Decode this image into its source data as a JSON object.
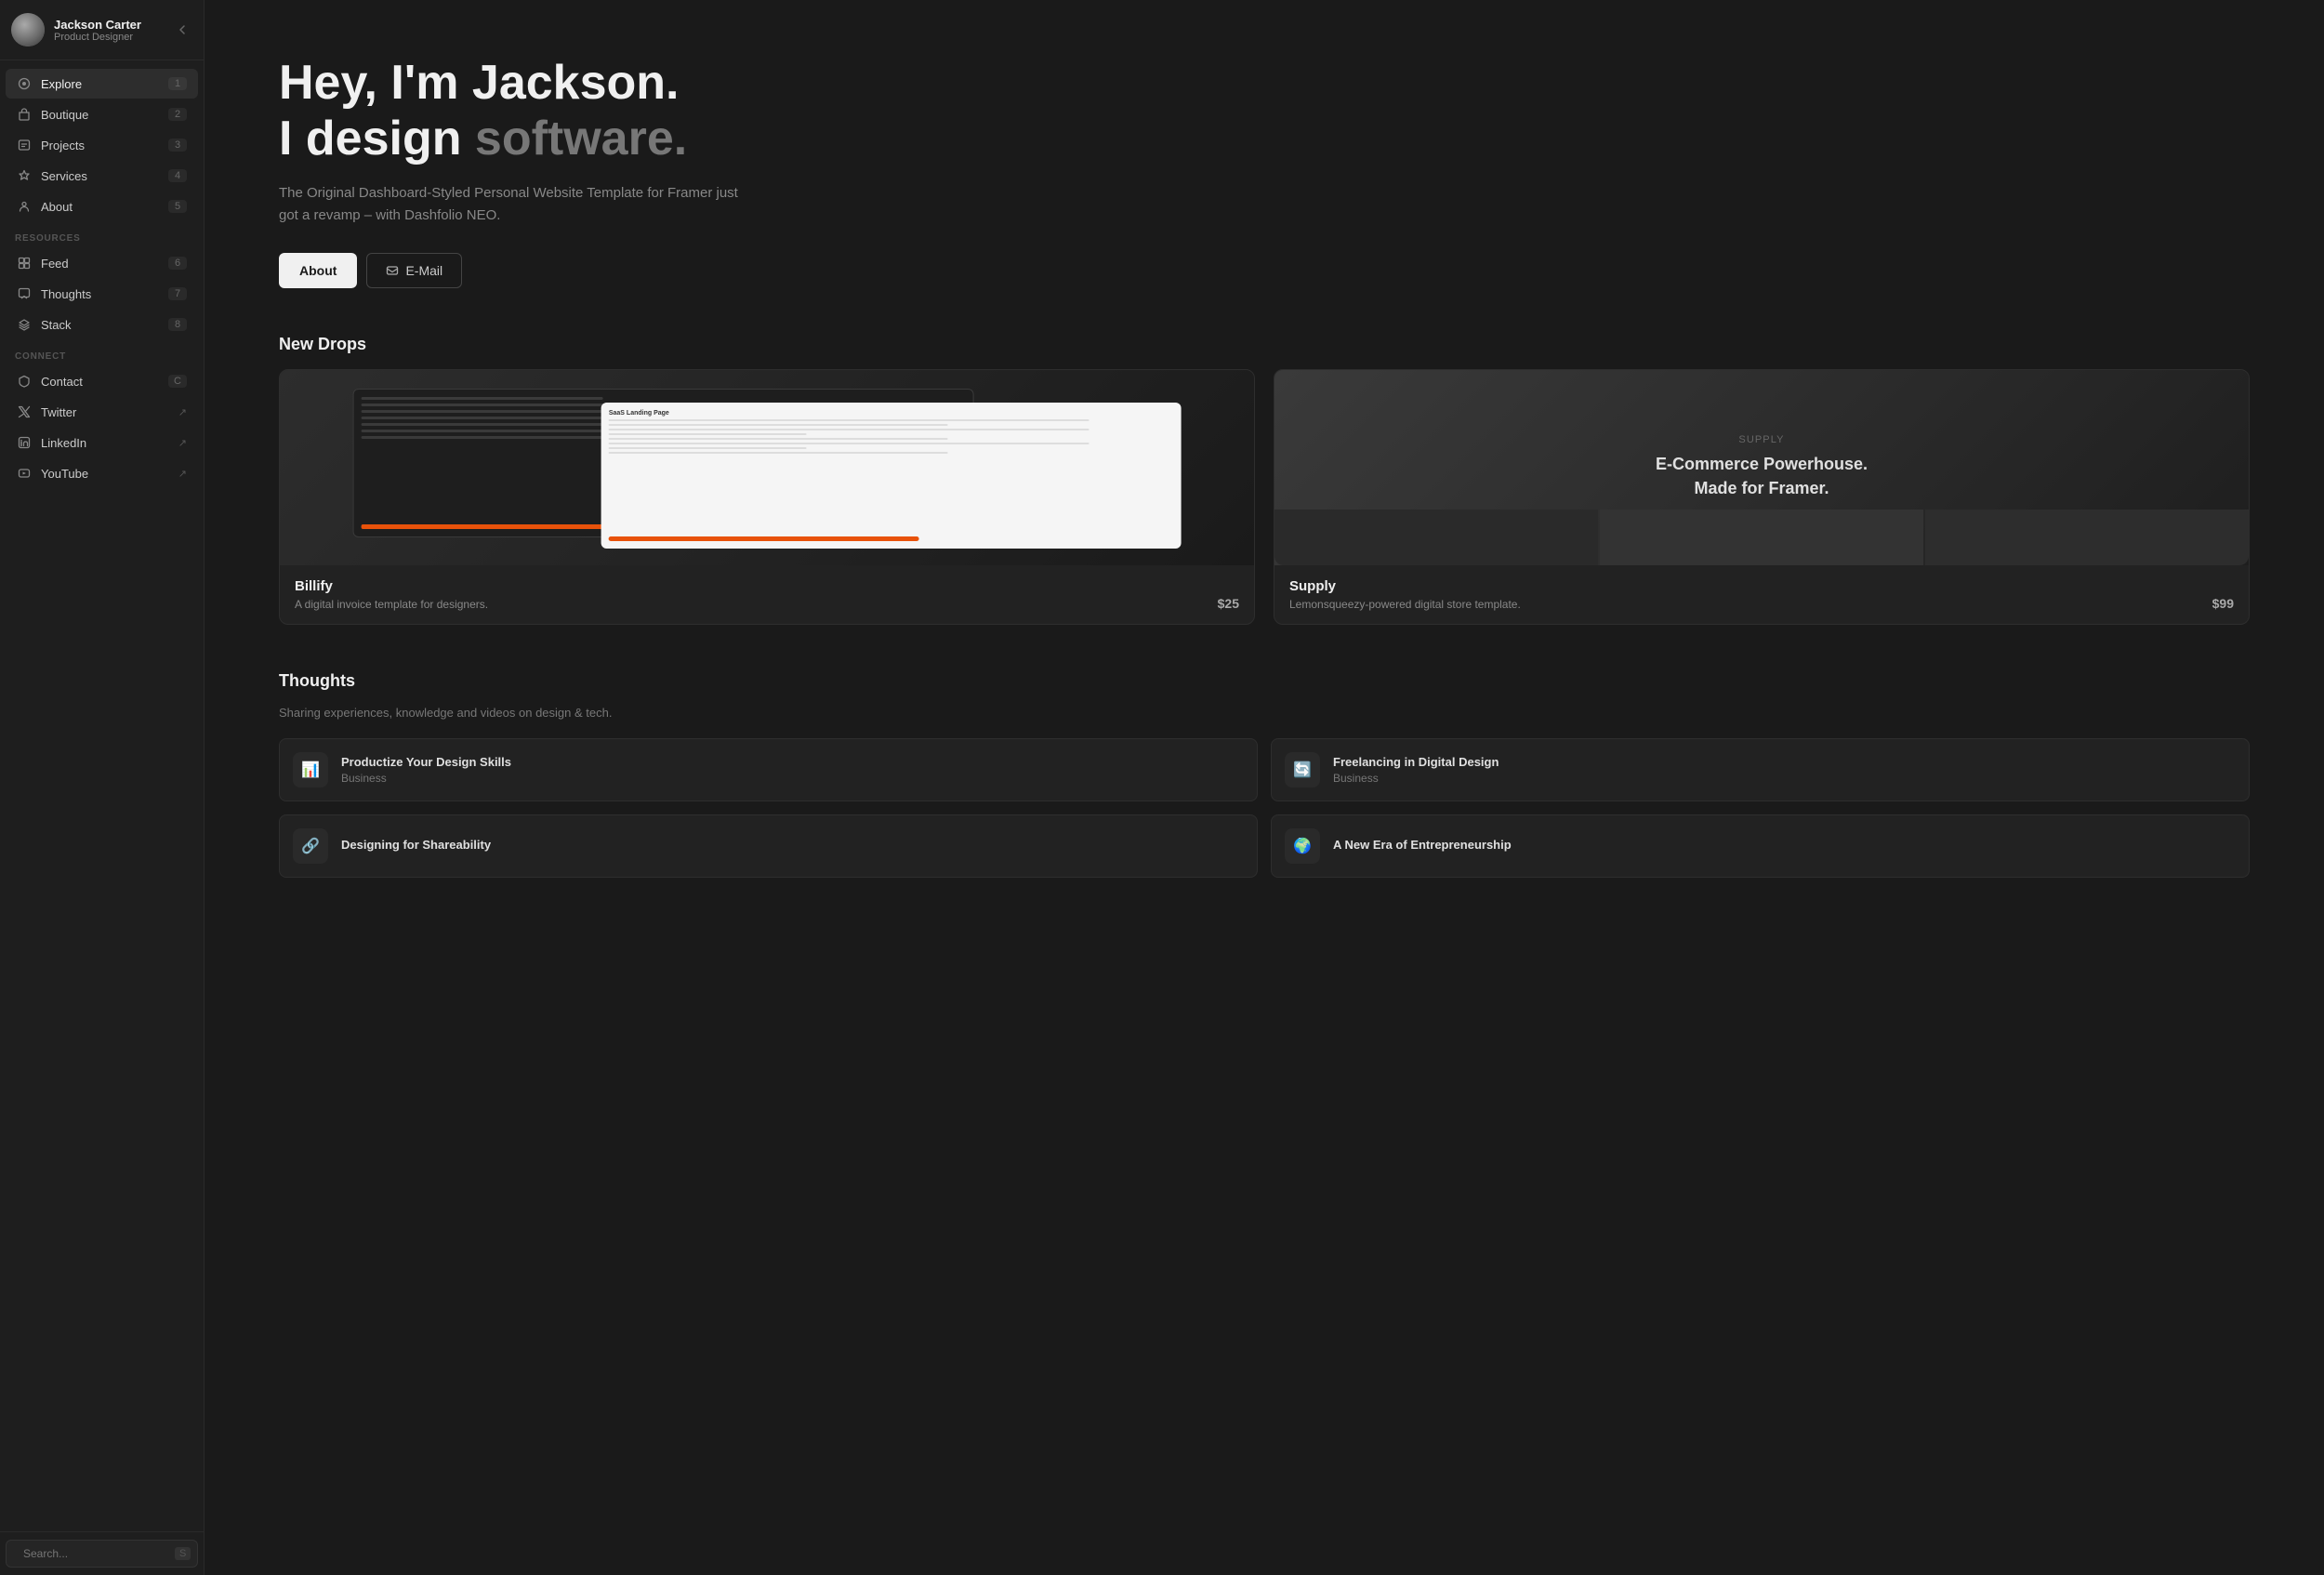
{
  "user": {
    "name": "Jackson Carter",
    "role": "Product Designer"
  },
  "sidebar": {
    "collapse_label": "‹",
    "nav_items": [
      {
        "id": "explore",
        "label": "Explore",
        "badge": "1",
        "active": true
      },
      {
        "id": "boutique",
        "label": "Boutique",
        "badge": "2",
        "active": false
      },
      {
        "id": "projects",
        "label": "Projects",
        "badge": "3",
        "active": false
      },
      {
        "id": "services",
        "label": "Services",
        "badge": "4",
        "active": false
      },
      {
        "id": "about",
        "label": "About",
        "badge": "5",
        "active": false
      }
    ],
    "resources_label": "RESOURCES",
    "resource_items": [
      {
        "id": "feed",
        "label": "Feed",
        "badge": "6"
      },
      {
        "id": "thoughts",
        "label": "Thoughts",
        "badge": "7"
      },
      {
        "id": "stack",
        "label": "Stack",
        "badge": "8"
      }
    ],
    "connect_label": "CONNECT",
    "connect_items": [
      {
        "id": "contact",
        "label": "Contact",
        "shortcut": "C",
        "external": false
      },
      {
        "id": "twitter",
        "label": "Twitter",
        "shortcut": "↗",
        "external": true
      },
      {
        "id": "linkedin",
        "label": "LinkedIn",
        "shortcut": "↗",
        "external": true
      },
      {
        "id": "youtube",
        "label": "YouTube",
        "shortcut": "↗",
        "external": true
      }
    ],
    "search_placeholder": "Search...",
    "search_shortcut": "S"
  },
  "hero": {
    "title_line1": "Hey, I'm Jackson.",
    "title_line2_prefix": "I design ",
    "title_line2_highlight": "software.",
    "subtitle": "The Original Dashboard-Styled Personal Website Template for Framer just got a revamp – with Dashfolio NEO.",
    "btn_about": "About",
    "btn_email": "E-Mail"
  },
  "drops": {
    "section_title": "New Drops",
    "items": [
      {
        "id": "billify",
        "name": "Billify",
        "description": "A digital invoice template for designers.",
        "price": "$25"
      },
      {
        "id": "supply",
        "name": "Supply",
        "description": "Lemonsqueezy-powered digital store template.",
        "price": "$99"
      }
    ]
  },
  "thoughts": {
    "section_title": "Thoughts",
    "subtitle": "Sharing experiences, knowledge and videos on design & tech.",
    "items": [
      {
        "id": "productize",
        "title": "Productize Your Design Skills",
        "category": "Business",
        "icon": "📊"
      },
      {
        "id": "freelancing",
        "title": "Freelancing in Digital Design",
        "category": "Business",
        "icon": "🔄"
      },
      {
        "id": "shareability",
        "title": "Designing for Shareability",
        "category": "",
        "icon": "🔗"
      },
      {
        "id": "entrepreneurship",
        "title": "A New Era of Entrepreneurship",
        "category": "",
        "icon": "🌍"
      }
    ]
  }
}
